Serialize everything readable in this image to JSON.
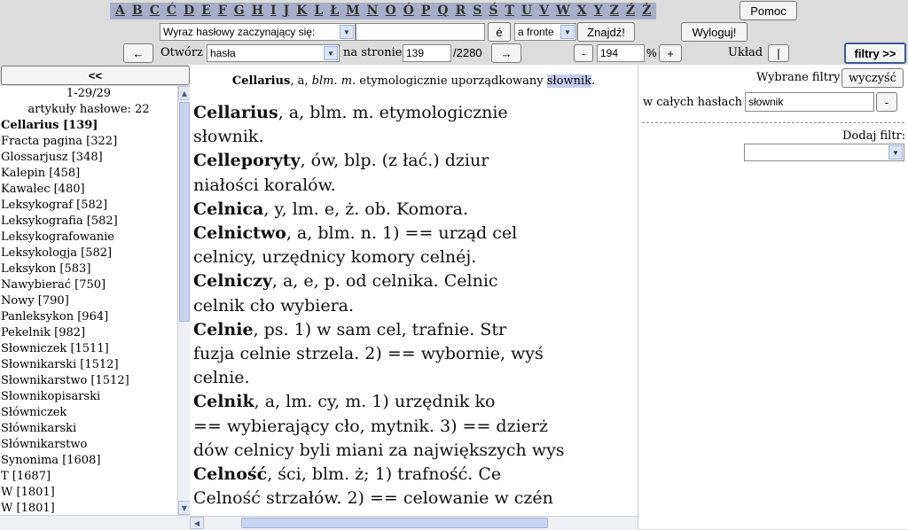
{
  "alphabet": [
    "A",
    "B",
    "C",
    "Ć",
    "D",
    "E",
    "F",
    "G",
    "H",
    "I",
    "J",
    "K",
    "L",
    "Ł",
    "M",
    "N",
    "O",
    "Ó",
    "P",
    "Q",
    "R",
    "S",
    "Ś",
    "T",
    "U",
    "V",
    "W",
    "X",
    "Y",
    "Z",
    "Ź",
    "Ż"
  ],
  "toolbar": {
    "help_label": "Pomoc",
    "search_mode": "Wyraz hasłowy zaczynający się:",
    "search_value": "",
    "special_char_label": "é",
    "match_mode": "a fronte",
    "find_label": "Znajdź!",
    "logout_label": "Wyloguj!",
    "back_label": "←",
    "open_label": "Otwórz",
    "open_target": "hasła",
    "on_page_label": "na stronie",
    "page_number": "139",
    "page_total": "/2280",
    "forward_label": "→",
    "zoom_minus": "-",
    "zoom_value": "194",
    "zoom_unit": "%",
    "zoom_plus": "+",
    "layout_label": "Układ",
    "layout_toggle": "|",
    "filters_label": "filtry >>"
  },
  "left": {
    "collapse_label": "<<",
    "range": "1-29/29",
    "count_label": "artykuły hasłowe: 22",
    "items": [
      {
        "text": "Cellarius [139]",
        "active": true
      },
      {
        "text": "Fracta pagina [322]"
      },
      {
        "text": "Glossarjusz [348]"
      },
      {
        "text": "Kalepin [458]"
      },
      {
        "text": "Kawalec [480]"
      },
      {
        "text": "Leksykograf [582]"
      },
      {
        "text": "Leksykografia [582]"
      },
      {
        "text": "Leksykografowanie"
      },
      {
        "text": "Leksykologja [582]"
      },
      {
        "text": "Leksykon [583]"
      },
      {
        "text": "Nawybierać [750]"
      },
      {
        "text": "Nowy [790]"
      },
      {
        "text": "Panleksykon [964]"
      },
      {
        "text": "Pekelnik [982]"
      },
      {
        "text": "Słowniczek [1511]"
      },
      {
        "text": "Słownikarski [1512]"
      },
      {
        "text": "Słownikarstwo [1512]"
      },
      {
        "text": "Słownikopisarski"
      },
      {
        "text": "Słówniczek"
      },
      {
        "text": "Słównikarski"
      },
      {
        "text": "Słównikarstwo"
      },
      {
        "text": "Synonima [1608]"
      },
      {
        "text": "T [1687]"
      },
      {
        "text": "W [1801]"
      },
      {
        "text": "W [1801]"
      }
    ]
  },
  "center": {
    "headword": "Cellarius",
    "head_rest_1": ", a,",
    "head_gram": " blm. m.",
    "head_rest_2": " etymologicznie uporządkowany ",
    "head_highlight": "słownik",
    "head_end": ".",
    "scan_lines": [
      "Cellarius, a, blm. m. etymologicznie",
      "słownik.",
      "Celleporyty, ów, blp. (z łać.) dziur",
      "niałości koralów.",
      "Celnica, y, lm. e, ż. ob. Komora.",
      "Celnictwo, a, blm. n. 1) == urząd cel",
      "celnicy, urzędnicy komory celnéj.",
      "Celniczy, a, e, p. od celnika. Celnic",
      "celnik cło wybiera.",
      "Celnie, ps. 1) w sam cel, trafnie. Str",
      "fuzja celnie strzela. 2) == wybornie, wyś",
      "celnie.",
      "Celnik, a, lm. cy, m. 1) urzędnik ko",
      "== wybierający cło, mytnik. 3) == dzierż",
      "dów celnicy byli miani za największych wys",
      "Celność, ści, blm. ż; 1) trafność. Ce",
      "Celność strzałów. 2) == celowanie w czén"
    ]
  },
  "right": {
    "selected_filters_label": "Wybrane filtry",
    "clear_label": "wyczyść",
    "scope_label": "w całych hasłach",
    "filter_value": "słownik",
    "remove_label": "-",
    "add_filter_label": "Dodaj filtr:",
    "add_filter_value": ""
  }
}
